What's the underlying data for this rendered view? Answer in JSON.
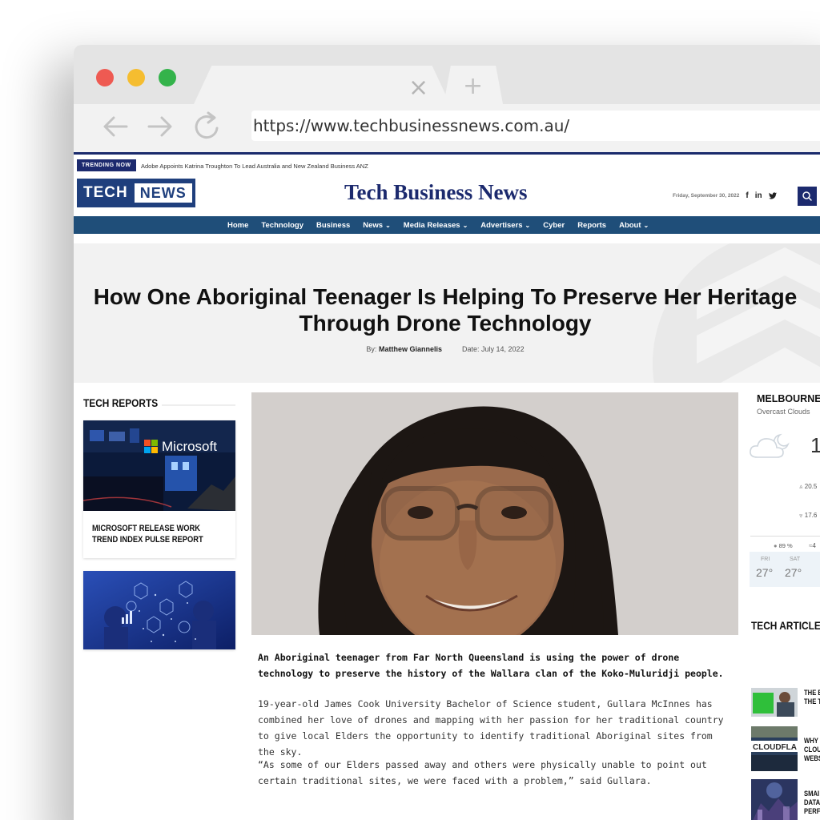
{
  "browser": {
    "url": "https://www.techbusinessnews.com.au/",
    "tab_close": "×",
    "newtab": "+"
  },
  "trending": {
    "badge": "TRENDING NOW",
    "text": "Adobe Appoints Katrina Troughton To Lead Australia and New Zealand Business ANZ"
  },
  "header": {
    "logo_tech": "TECH",
    "logo_news": "NEWS",
    "title": "Tech Business News",
    "date": "Friday, September 30, 2022",
    "social": [
      "f",
      "in",
      "🐦"
    ]
  },
  "nav": {
    "items": [
      {
        "label": "Home",
        "caret": ""
      },
      {
        "label": "Technology",
        "caret": ""
      },
      {
        "label": "Business",
        "caret": ""
      },
      {
        "label": "News",
        "caret": "⌄"
      },
      {
        "label": "Media Releases",
        "caret": "⌄"
      },
      {
        "label": "Advertisers",
        "caret": "⌄"
      },
      {
        "label": "Cyber",
        "caret": ""
      },
      {
        "label": "Reports",
        "caret": ""
      },
      {
        "label": "About",
        "caret": "⌄"
      }
    ]
  },
  "article": {
    "headline": "How One Aboriginal Teenager Is Helping To Preserve Her Heritage Through Drone Technology",
    "by_label": "By:",
    "author": "Matthew Giannelis",
    "date_label": "Date:",
    "date": "July 14, 2022",
    "lead": "An Aboriginal teenager from Far North Queensland is using the power of drone technology to preserve the history of the Wallara clan of the Koko-Muluridji people.",
    "p1": "19-year-old James Cook University Bachelor of Science student, Gullara McInnes has combined her love of drones and mapping with her passion for her traditional country to give local Elders the opportunity to identify traditional Aboriginal sites from the sky.",
    "p2": "“As some of our Elders passed away and others were physically unable to point out certain traditional sites, we were faced with a problem,” said Gullara."
  },
  "left_sidebar": {
    "heading": "TECH REPORTS",
    "card1_logo": "Microsoft",
    "card1_title": "MICROSOFT RELEASE WORK TREND INDEX PULSE REPORT"
  },
  "weather": {
    "city": "MELBOURNE",
    "desc": "Overcast Clouds",
    "temp": "1",
    "hi": "20.5",
    "lo": "17.6",
    "humidity": "89 %",
    "wind": "4",
    "days": [
      {
        "day": "FRI",
        "temp": "27°"
      },
      {
        "day": "SAT",
        "temp": "27°"
      }
    ]
  },
  "tech_articles": {
    "heading": "TECH ARTICLES",
    "items": [
      {
        "l1": "THE B",
        "l2": "THE T",
        "l3": ""
      },
      {
        "l1": "WHY",
        "l2": "CLOU",
        "l3": "WEBS"
      },
      {
        "l1": "SMAI",
        "l2": "DATA",
        "l3": "PERF"
      }
    ],
    "img2_text": "CLOUDFLA"
  }
}
